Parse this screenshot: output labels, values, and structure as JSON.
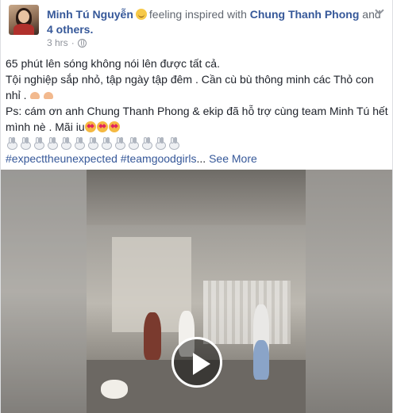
{
  "post": {
    "author": "Minh Tú Nguyễn",
    "feeling_text": "feeling inspired with",
    "tagged": "Chung Thanh Phong",
    "and_text": "and",
    "others": "4 others.",
    "time": "3 hrs",
    "line1": "65 phút lên sóng không nói lên được tất cả.",
    "line2": "Tội nghiệp sắp nhỏ, tập ngày tập đêm . Cần cù bù thông minh các Thỏ con",
    "line3": "nhỉ .",
    "line4": "Ps: cám ơn anh Chung Thanh Phong & ekip đã hỗ trợ cùng team Minh Tú hết",
    "line5": "mình nè . Mãi iu",
    "hashtags": "#expecttheunexpected #teamgoodgirls",
    "ellipsis": "...",
    "see_more": "See More"
  },
  "icons": {
    "avatar": "profile-photo",
    "feeling": "smiling-face-icon",
    "privacy": "globe-icon",
    "menu": "chevron-down-icon",
    "play": "play-icon"
  },
  "emoji": {
    "biceps_count": 2,
    "hearts_count": 3,
    "bunnies_count": 13
  },
  "colors": {
    "link": "#365899",
    "meta": "#90949c",
    "text": "#1d2129"
  }
}
